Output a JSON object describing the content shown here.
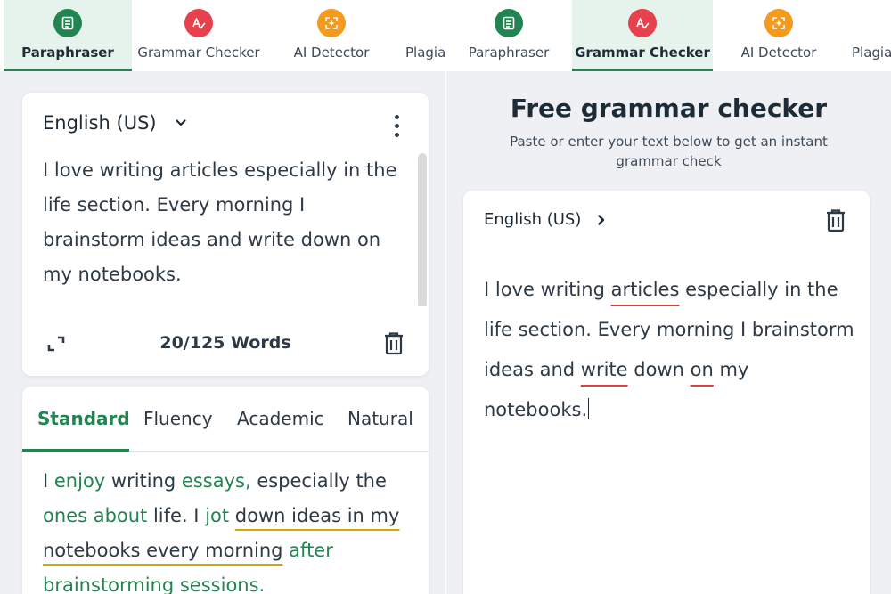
{
  "left": {
    "nav": [
      {
        "label": "Paraphraser",
        "icon": "paraphraser-doc-icon",
        "color": "#228450",
        "active": true
      },
      {
        "label": "Grammar Checker",
        "icon": "grammar-check-icon",
        "color": "#e5424d"
      },
      {
        "label": "AI Detector",
        "icon": "ai-detector-icon",
        "color": "#f39a1f"
      },
      {
        "label": "Plagiarism Checker",
        "icon": "plagiarism-icon"
      }
    ],
    "input": {
      "language": "English (US)",
      "text": "I love writing articles especially in the life section. Every morning I brainstorm ideas and write down on my notebooks.",
      "word_count": "20/125 Words"
    },
    "modes": [
      "Standard",
      "Fluency",
      "Academic",
      "Natural"
    ],
    "output": {
      "segments": [
        {
          "t": "I "
        },
        {
          "t": "enjoy",
          "g": true
        },
        {
          "t": " writing "
        },
        {
          "t": "essays,",
          "g": true
        },
        {
          "t": " especially the "
        },
        {
          "t": "ones about",
          "g": true
        },
        {
          "t": " life. I "
        },
        {
          "t": "jot",
          "g": true
        },
        {
          "t": " "
        },
        {
          "t": "down ideas in my notebooks every morning",
          "u": true
        },
        {
          "t": " "
        },
        {
          "t": "after brainstorming sessions.",
          "g": true
        }
      ]
    }
  },
  "right": {
    "nav": [
      {
        "label": "Paraphraser",
        "icon": "paraphraser-doc-icon",
        "color": "#228450"
      },
      {
        "label": "Grammar Checker",
        "icon": "grammar-check-icon",
        "color": "#e5424d",
        "active": true
      },
      {
        "label": "AI Detector",
        "icon": "ai-detector-icon",
        "color": "#f39a1f"
      },
      {
        "label": "Plagiarism Checker",
        "icon": "plagiarism-icon"
      }
    ],
    "title": "Free grammar checker",
    "subtitle": "Paste or enter your text below to get an instant grammar check",
    "editor": {
      "language": "English (US)",
      "segments": [
        {
          "t": "I love writing "
        },
        {
          "t": "articles",
          "e": true
        },
        {
          "t": " especially in the life section. Every morning I brainstorm ideas and "
        },
        {
          "t": "write",
          "e": true
        },
        {
          "t": " down "
        },
        {
          "t": "on",
          "e": true
        },
        {
          "t": " my notebooks."
        }
      ]
    }
  }
}
